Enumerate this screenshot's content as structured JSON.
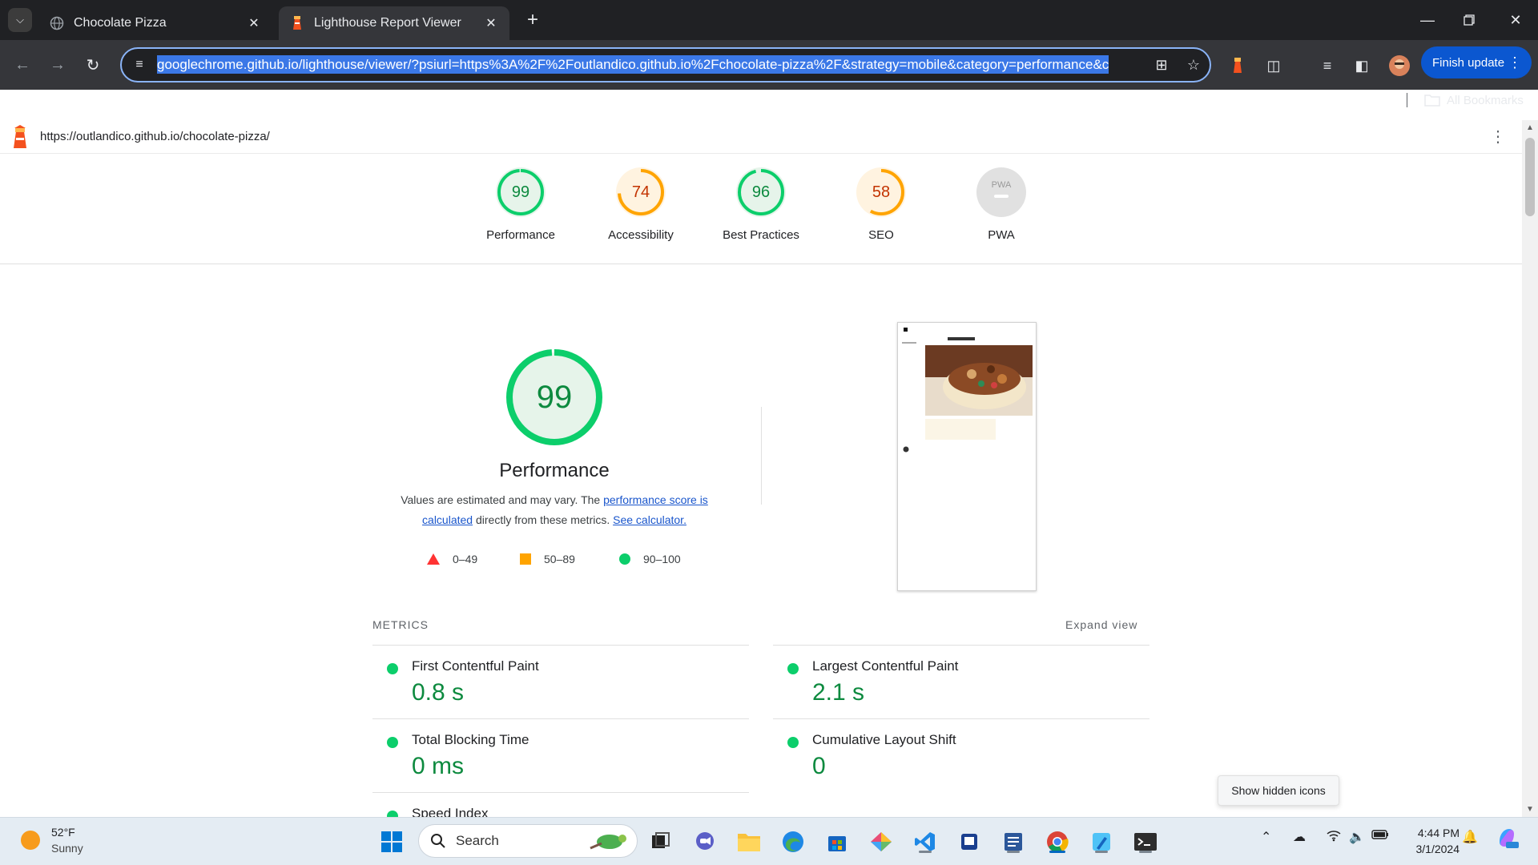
{
  "browser": {
    "tabs": [
      {
        "title": "Chocolate Pizza",
        "active": false
      },
      {
        "title": "Lighthouse Report Viewer",
        "active": true
      }
    ],
    "address_bar": {
      "url": "googlechrome.github.io/lighthouse/viewer/?psiurl=https%3A%2F%2Foutlandico.github.io%2Fchocolate-pizza%2F&strategy=mobile&category=performance&c"
    },
    "finish_update_label": "Finish update",
    "bookmarks_label": "All Bookmarks"
  },
  "report": {
    "page_url": "https://outlandico.github.io/chocolate-pizza/",
    "gauges": [
      {
        "score": "99",
        "label": "Performance",
        "status": "pass",
        "fraction": 0.99
      },
      {
        "score": "74",
        "label": "Accessibility",
        "status": "average",
        "fraction": 0.74
      },
      {
        "score": "96",
        "label": "Best Practices",
        "status": "pass",
        "fraction": 0.96
      },
      {
        "score": "58",
        "label": "SEO",
        "status": "average",
        "fraction": 0.58
      },
      {
        "score": "PWA",
        "label": "PWA",
        "status": "na",
        "fraction": 0
      }
    ],
    "performance": {
      "score": "99",
      "fraction": 0.99,
      "title": "Performance",
      "desc_prefix": "Values are estimated and may vary. The ",
      "desc_link1": "performance score is calculated",
      "desc_middle": " directly from these metrics. ",
      "desc_link2": "See calculator."
    },
    "legend": [
      {
        "range": "0–49",
        "shape": "triangle",
        "color": "#ff3333"
      },
      {
        "range": "50–89",
        "shape": "square",
        "color": "#ffa400"
      },
      {
        "range": "90–100",
        "shape": "circle",
        "color": "#0cce6b"
      }
    ],
    "metrics_heading": "METRICS",
    "expand_view": "Expand view",
    "metrics": [
      {
        "name": "First Contentful Paint",
        "value": "0.8 s"
      },
      {
        "name": "Largest Contentful Paint",
        "value": "2.1 s"
      },
      {
        "name": "Total Blocking Time",
        "value": "0 ms"
      },
      {
        "name": "Cumulative Layout Shift",
        "value": "0"
      },
      {
        "name": "Speed Index",
        "value": ""
      }
    ]
  },
  "tooltip": "Show hidden icons",
  "taskbar": {
    "weather_temp": "52°F",
    "weather_cond": "Sunny",
    "search_label": "Search",
    "time": "4:44 PM",
    "date": "3/1/2024"
  },
  "colors": {
    "pass": "#0cce6b",
    "pass_text": "#0d8a3f",
    "average": "#ffa400",
    "average_text": "#c33300",
    "link": "#1a56cc",
    "omnibox_border": "#8ab4f8"
  }
}
